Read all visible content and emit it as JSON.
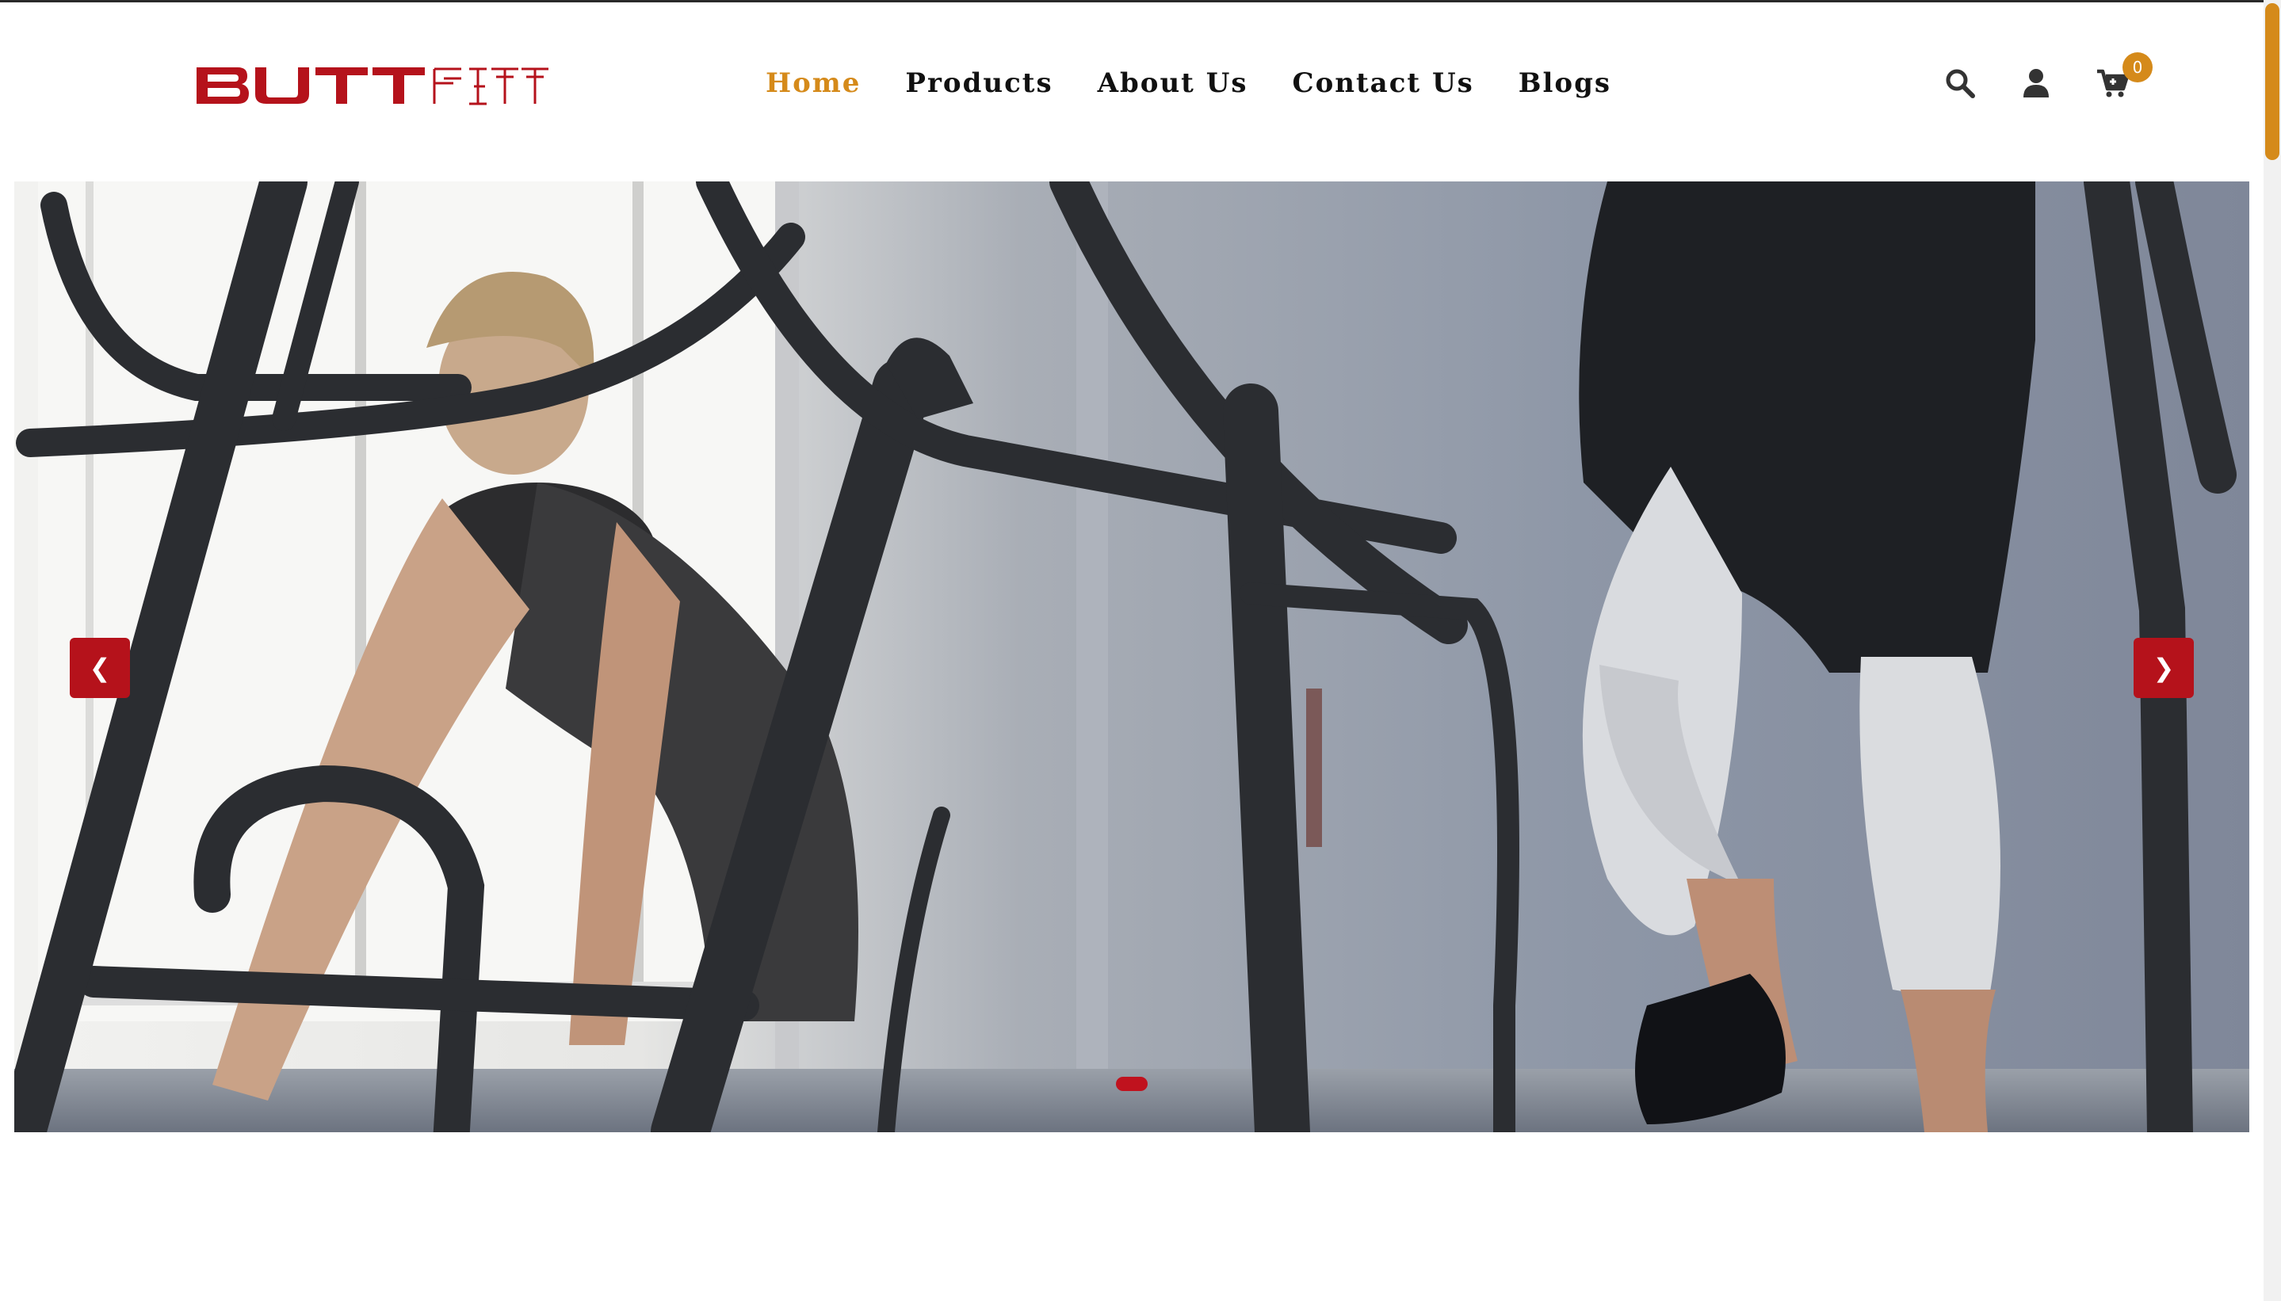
{
  "brand": {
    "name": "BUTTFITT",
    "logo_part1": "BUTT",
    "logo_part2": "FITT",
    "logo_color": "#b5121b"
  },
  "nav": {
    "items": [
      {
        "label": "Home",
        "active": true
      },
      {
        "label": "Products",
        "active": false
      },
      {
        "label": "About Us",
        "active": false
      },
      {
        "label": "Contact Us",
        "active": false
      },
      {
        "label": "Blogs",
        "active": false
      }
    ]
  },
  "header_icons": {
    "search": "search-icon",
    "account": "user-icon",
    "cart": "cart-icon",
    "cart_count": "0"
  },
  "hero": {
    "prev_label": "❮",
    "next_label": "❯",
    "slide_count": 1,
    "active_slide": 1
  },
  "colors": {
    "accent": "#d58a1a",
    "brand_red": "#b5121b",
    "nav_text": "#111111"
  }
}
